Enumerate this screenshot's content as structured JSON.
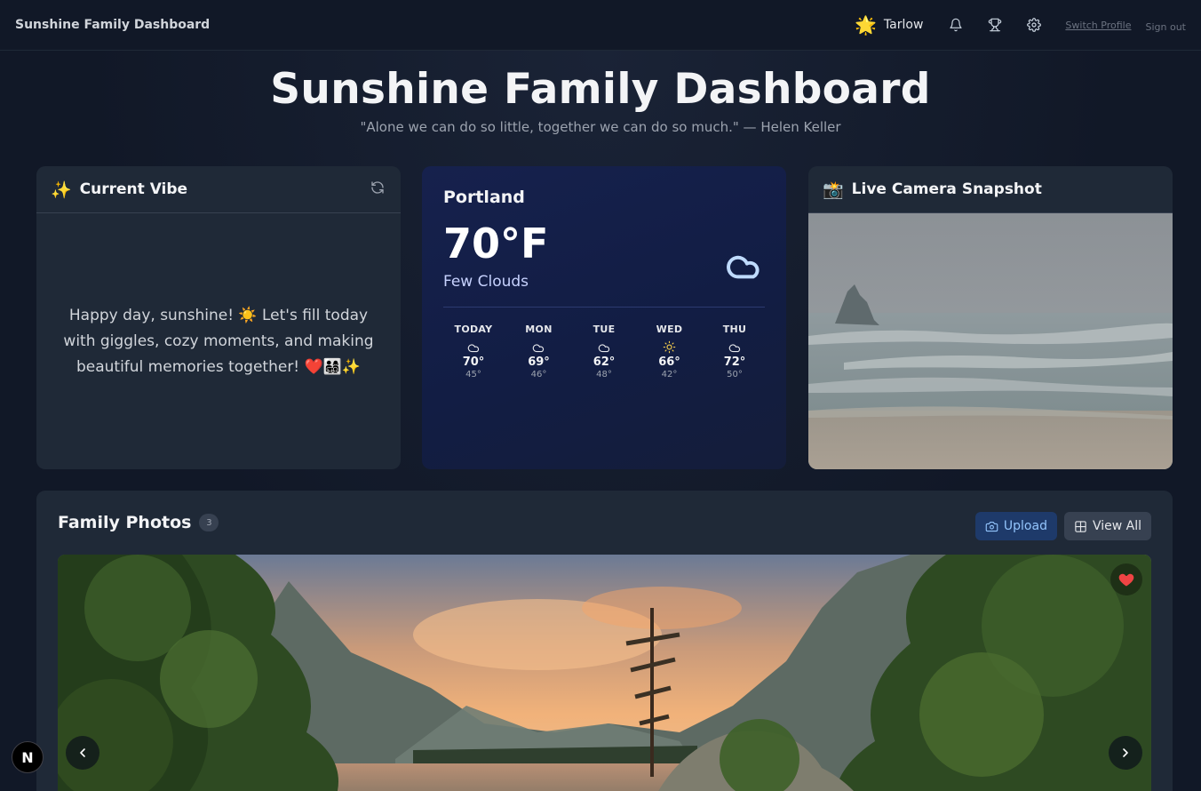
{
  "topbar": {
    "brand": "Sunshine Family Dashboard",
    "user_emoji": "🌟",
    "user_name": "Tarlow",
    "icons": [
      "bell-icon",
      "trophy-icon",
      "gear-icon"
    ],
    "switch_profile": "Switch Profile",
    "sign_out": "Sign out"
  },
  "hero": {
    "title": "Sunshine Family Dashboard",
    "quote": "\"Alone we can do so little, together we can do so much.\" — Helen Keller"
  },
  "vibe": {
    "emoji": "✨",
    "title": "Current Vibe",
    "message": "Happy day, sunshine! ☀️ Let's fill today with giggles, cozy moments, and making beautiful memories together! ❤️👨‍👩‍👧‍👦✨"
  },
  "weather": {
    "city": "Portland",
    "temp": "70°F",
    "condition": "Few Clouds",
    "icon": "cloud-icon",
    "forecast": [
      {
        "day": "TODAY",
        "icon": "cloud-icon",
        "high": "70°",
        "low": "45°"
      },
      {
        "day": "MON",
        "icon": "cloud-icon",
        "high": "69°",
        "low": "46°"
      },
      {
        "day": "TUE",
        "icon": "cloud-icon",
        "high": "62°",
        "low": "48°"
      },
      {
        "day": "WED",
        "icon": "sun-icon",
        "high": "66°",
        "low": "42°"
      },
      {
        "day": "THU",
        "icon": "cloud-icon",
        "high": "72°",
        "low": "50°"
      }
    ]
  },
  "camera": {
    "emoji": "📸",
    "title": "Live Camera Snapshot"
  },
  "photos": {
    "title": "Family Photos",
    "count": "3",
    "upload_label": "Upload",
    "view_all_label": "View All"
  },
  "badge": {
    "letter": "N"
  },
  "colors": {
    "background": "#111827",
    "card": "#1f2937",
    "weather_card": "#16214d",
    "accent_blue": "#93c5fd",
    "heart": "#ef4444"
  }
}
